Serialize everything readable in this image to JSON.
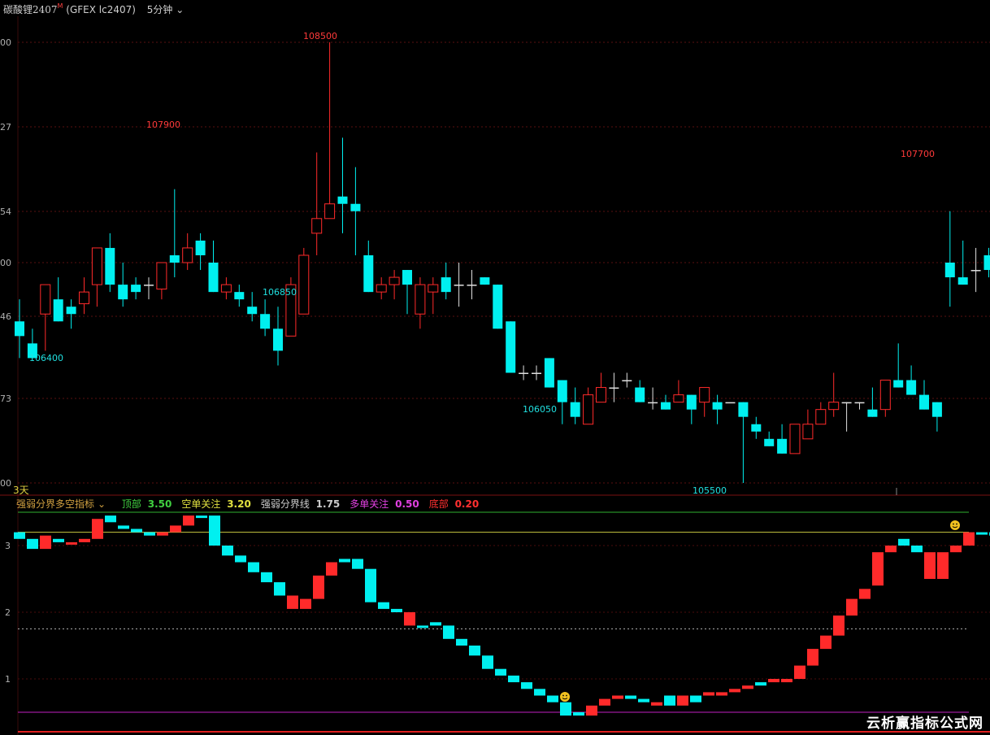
{
  "header": {
    "symbol": "碳酸锂2407",
    "badge": "M",
    "code": "(GFEX lc2407)",
    "period": "5分钟"
  },
  "main_axis_labels": [
    "00",
    "27",
    "54",
    "00",
    "46",
    "73",
    "00"
  ],
  "price_annotations": [
    {
      "text": "108500",
      "kind": "high"
    },
    {
      "text": "107900",
      "kind": "high"
    },
    {
      "text": "107700",
      "kind": "high"
    },
    {
      "text": "106850",
      "kind": "low"
    },
    {
      "text": "106400",
      "kind": "low"
    },
    {
      "text": "106050",
      "kind": "low"
    },
    {
      "text": "105500",
      "kind": "low"
    }
  ],
  "indicator": {
    "days": "3天",
    "name": "强弱分界多空指标",
    "items": [
      {
        "label": "顶部",
        "value": "3.50",
        "color": "#40d040"
      },
      {
        "label": "空单关注",
        "value": "3.20",
        "color": "#e0e040"
      },
      {
        "label": "强弱分界线",
        "value": "1.75",
        "color": "#cccccc"
      },
      {
        "label": "多单关注",
        "value": "0.50",
        "color": "#e040e0"
      },
      {
        "label": "底部",
        "value": "0.20",
        "color": "#ff3030"
      }
    ],
    "axis_labels": [
      "3",
      "2",
      "1"
    ]
  },
  "watermark": "云析赢指标公式网",
  "colors": {
    "up": "#ff2a2a",
    "down": "#00f0f0",
    "doji": "#e0e0e0"
  },
  "chart_data": [
    {
      "type": "candlestick",
      "title": "碳酸锂2407 5分钟",
      "y_range": [
        105500,
        108500
      ],
      "ohlc": [
        [
          106600,
          106750,
          106350,
          106500
        ],
        [
          106450,
          106550,
          106400,
          106350
        ],
        [
          106650,
          106850,
          106400,
          106850
        ],
        [
          106750,
          106900,
          106650,
          106600
        ],
        [
          106700,
          106750,
          106550,
          106650
        ],
        [
          106720,
          106900,
          106650,
          106800
        ],
        [
          106850,
          107000,
          106700,
          107100
        ],
        [
          107100,
          107200,
          106800,
          106850
        ],
        [
          106850,
          107000,
          106700,
          106750
        ],
        [
          106850,
          106900,
          106750,
          106800
        ],
        [
          106850,
          106900,
          106750,
          106850
        ],
        [
          106820,
          106950,
          106750,
          107000
        ],
        [
          107050,
          107500,
          106900,
          107000
        ],
        [
          107000,
          107200,
          106950,
          107100
        ],
        [
          107150,
          107200,
          106950,
          107050
        ],
        [
          107000,
          107150,
          106800,
          106800
        ],
        [
          106800,
          106900,
          106750,
          106850
        ],
        [
          106800,
          106850,
          106700,
          106750
        ],
        [
          106700,
          106800,
          106600,
          106650
        ],
        [
          106650,
          106750,
          106500,
          106550
        ],
        [
          106550,
          106700,
          106300,
          106400
        ],
        [
          106500,
          106900,
          106550,
          106850
        ],
        [
          106650,
          107100,
          106800,
          107050
        ],
        [
          107200,
          107750,
          107050,
          107300
        ],
        [
          107300,
          108500,
          107300,
          107400
        ],
        [
          107450,
          107850,
          107200,
          107400
        ],
        [
          107400,
          107650,
          107050,
          107350
        ],
        [
          107050,
          107150,
          106900,
          106800
        ],
        [
          106800,
          106900,
          106750,
          106850
        ],
        [
          106850,
          106950,
          106750,
          106900
        ],
        [
          106950,
          106900,
          106650,
          106850
        ],
        [
          106650,
          106900,
          106550,
          106850
        ],
        [
          106800,
          106900,
          106650,
          106850
        ],
        [
          106900,
          107000,
          106750,
          106800
        ],
        [
          106850,
          107000,
          106700,
          106850
        ],
        [
          106850,
          106950,
          106750,
          106850
        ],
        [
          106900,
          106850,
          106850,
          106850
        ],
        [
          106850,
          106700,
          106600,
          106550
        ],
        [
          106600,
          106500,
          106250,
          106250
        ],
        [
          106250,
          106300,
          106200,
          106250
        ],
        [
          106250,
          106300,
          106200,
          106250
        ],
        [
          106350,
          106350,
          106150,
          106150
        ],
        [
          106200,
          106150,
          105900,
          106050
        ],
        [
          106050,
          106150,
          105900,
          105950
        ],
        [
          105900,
          106150,
          106050,
          106100
        ],
        [
          106050,
          106250,
          106050,
          106150
        ],
        [
          106150,
          106250,
          106050,
          106150
        ],
        [
          106200,
          106250,
          106150,
          106200
        ],
        [
          106150,
          106200,
          106050,
          106050
        ],
        [
          106050,
          106150,
          106000,
          106050
        ],
        [
          106050,
          106100,
          106000,
          106000
        ],
        [
          106050,
          106200,
          106100,
          106100
        ],
        [
          106100,
          106100,
          105900,
          106000
        ],
        [
          106050,
          106100,
          105950,
          106150
        ],
        [
          106050,
          106100,
          105900,
          106000
        ],
        [
          106050,
          106050,
          106050,
          106050
        ],
        [
          106050,
          105950,
          105500,
          105950
        ],
        [
          105900,
          105950,
          105800,
          105850
        ],
        [
          105800,
          105850,
          105750,
          105750
        ],
        [
          105800,
          105900,
          105700,
          105700
        ],
        [
          105700,
          105900,
          105800,
          105900
        ],
        [
          105800,
          106000,
          105800,
          105900
        ],
        [
          105900,
          106050,
          105900,
          106000
        ],
        [
          106000,
          106250,
          105950,
          106050
        ],
        [
          106050,
          106000,
          105850,
          106050
        ],
        [
          106050,
          106050,
          106000,
          106050
        ],
        [
          106000,
          106150,
          106100,
          105950
        ],
        [
          106000,
          106200,
          105950,
          106200
        ],
        [
          106200,
          106450,
          106250,
          106150
        ],
        [
          106200,
          106300,
          106150,
          106100
        ],
        [
          106100,
          106200,
          106000,
          106000
        ],
        [
          106050,
          106000,
          105850,
          105950
        ],
        [
          107000,
          107350,
          106700,
          106900
        ],
        [
          106900,
          107150,
          106850,
          106850
        ],
        [
          106950,
          107100,
          106800,
          106950
        ],
        [
          107050,
          107100,
          106900,
          106950
        ],
        [
          106950,
          106950,
          106850,
          106850
        ],
        [
          106850,
          106950,
          106800,
          106800
        ]
      ]
    },
    {
      "type": "bar",
      "title": "强弱分界多空指标",
      "y_range": [
        0,
        3.6
      ],
      "thresholds": {
        "顶部": 3.5,
        "空单关注": 3.2,
        "强弱分界线": 1.75,
        "多单关注": 0.5,
        "底部": 0.2
      },
      "segments": [
        [
          3.1,
          3.2
        ],
        [
          2.95,
          3.1
        ],
        [
          2.95,
          3.15
        ],
        [
          3.05,
          3.1
        ],
        [
          3.05,
          3.05
        ],
        [
          3.05,
          3.1
        ],
        [
          3.1,
          3.4
        ],
        [
          3.35,
          3.45
        ],
        [
          3.25,
          3.3
        ],
        [
          3.2,
          3.25
        ],
        [
          3.15,
          3.2
        ],
        [
          3.15,
          3.2
        ],
        [
          3.2,
          3.3
        ],
        [
          3.3,
          3.45
        ],
        [
          3.45,
          3.45
        ],
        [
          3.0,
          3.45
        ],
        [
          2.85,
          3.0
        ],
        [
          2.75,
          2.85
        ],
        [
          2.6,
          2.75
        ],
        [
          2.45,
          2.6
        ],
        [
          2.25,
          2.45
        ],
        [
          2.05,
          2.25
        ],
        [
          2.05,
          2.2
        ],
        [
          2.2,
          2.55
        ],
        [
          2.55,
          2.75
        ],
        [
          2.75,
          2.8
        ],
        [
          2.65,
          2.8
        ],
        [
          2.15,
          2.65
        ],
        [
          2.05,
          2.15
        ],
        [
          2.0,
          2.05
        ],
        [
          1.8,
          2.0
        ],
        [
          1.8,
          1.8
        ],
        [
          1.8,
          1.85
        ],
        [
          1.6,
          1.8
        ],
        [
          1.5,
          1.6
        ],
        [
          1.35,
          1.5
        ],
        [
          1.15,
          1.35
        ],
        [
          1.05,
          1.15
        ],
        [
          0.95,
          1.05
        ],
        [
          0.85,
          0.95
        ],
        [
          0.75,
          0.85
        ],
        [
          0.65,
          0.75
        ],
        [
          0.45,
          0.65
        ],
        [
          0.45,
          0.5
        ],
        [
          0.45,
          0.6
        ],
        [
          0.6,
          0.7
        ],
        [
          0.7,
          0.75
        ],
        [
          0.7,
          0.75
        ],
        [
          0.65,
          0.7
        ],
        [
          0.6,
          0.65
        ],
        [
          0.6,
          0.75
        ],
        [
          0.6,
          0.75
        ],
        [
          0.65,
          0.75
        ],
        [
          0.75,
          0.8
        ],
        [
          0.75,
          0.8
        ],
        [
          0.8,
          0.85
        ],
        [
          0.85,
          0.9
        ],
        [
          0.9,
          0.95
        ],
        [
          0.95,
          1.0
        ],
        [
          0.95,
          1.0
        ],
        [
          1.0,
          1.2
        ],
        [
          1.2,
          1.45
        ],
        [
          1.45,
          1.65
        ],
        [
          1.65,
          1.95
        ],
        [
          1.95,
          2.2
        ],
        [
          2.2,
          2.35
        ],
        [
          2.4,
          2.9
        ],
        [
          2.9,
          3.0
        ],
        [
          3.0,
          3.1
        ],
        [
          3.0,
          2.9
        ],
        [
          2.5,
          2.9
        ],
        [
          2.5,
          2.9
        ],
        [
          2.9,
          3.0
        ],
        [
          3.0,
          3.2
        ],
        [
          3.2,
          3.2
        ],
        [
          3.15,
          3.2
        ],
        [
          3.15,
          3.1
        ]
      ],
      "colors": [
        "d",
        "d",
        "u",
        "d",
        "u",
        "u",
        "u",
        "d",
        "d",
        "d",
        "d",
        "u",
        "u",
        "u",
        "d",
        "d",
        "d",
        "d",
        "d",
        "d",
        "d",
        "u",
        "u",
        "u",
        "u",
        "d",
        "d",
        "d",
        "d",
        "d",
        "u",
        "d",
        "d",
        "d",
        "d",
        "d",
        "d",
        "d",
        "d",
        "d",
        "d",
        "d",
        "d",
        "d",
        "u",
        "u",
        "u",
        "d",
        "d",
        "u",
        "d",
        "u",
        "d",
        "u",
        "u",
        "u",
        "u",
        "d",
        "u",
        "u",
        "u",
        "u",
        "u",
        "u",
        "u",
        "u",
        "u",
        "u",
        "d",
        "d",
        "u",
        "u",
        "u",
        "u",
        "d",
        "d"
      ]
    }
  ]
}
